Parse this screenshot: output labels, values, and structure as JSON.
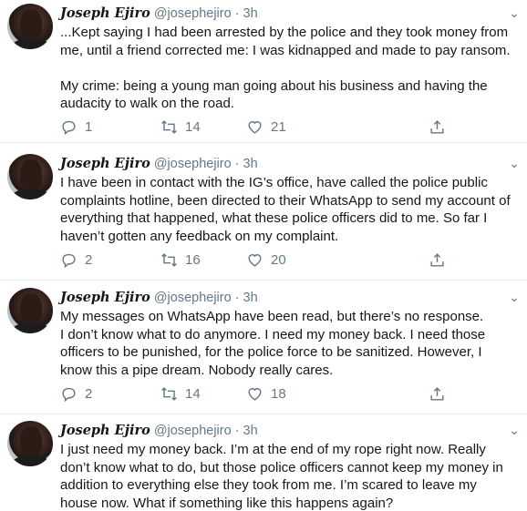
{
  "tweets": [
    {
      "name": "Joseph Ejiro",
      "handle": "@josephejiro",
      "time": "· 3h",
      "lines": [
        "...Kept saying I had been arrested by the police and they took money from me, until a friend corrected me: I was kidnapped and made to pay ransom.",
        "My crime: being a young man going about his business and having the audacity to walk on the road."
      ],
      "replies": "1",
      "retweets": "14",
      "likes": "21"
    },
    {
      "name": "Joseph Ejiro",
      "handle": "@josephejiro",
      "time": "· 3h",
      "lines": [
        "I have been in contact with the IG’s office, have called the police public complaints hotline, been directed to their WhatsApp to send my account of everything that happened, what these police officers did to me. So far I haven’t gotten any feedback on my complaint."
      ],
      "replies": "2",
      "retweets": "16",
      "likes": "20"
    },
    {
      "name": "Joseph Ejiro",
      "handle": "@josephejiro",
      "time": "· 3h",
      "lines": [
        "My messages on WhatsApp have been read, but there’s no response.",
        "I don’t know what to do anymore. I need my money back. I need those officers to be punished, for the police force to be sanitized. However, I know this a pipe dream. Nobody really cares."
      ],
      "replies": "2",
      "retweets": "14",
      "likes": "18"
    },
    {
      "name": "Joseph Ejiro",
      "handle": "@josephejiro",
      "time": "· 3h",
      "lines": [
        "I just need my money back. I’m at the end of my rope right now. Really don’t know what to do, but those police officers cannot keep my money in addition to everything else they took from me. I’m scared to leave my house now. What if something like this happens again?"
      ]
    }
  ],
  "icons": {
    "reply": "reply-icon",
    "retweet": "retweet-icon",
    "like": "heart-icon",
    "share": "share-icon",
    "more": "chevron-down-icon"
  },
  "colors": {
    "meta_gray": "#657786",
    "text": "#14171a",
    "divider": "#e6ecf0"
  }
}
